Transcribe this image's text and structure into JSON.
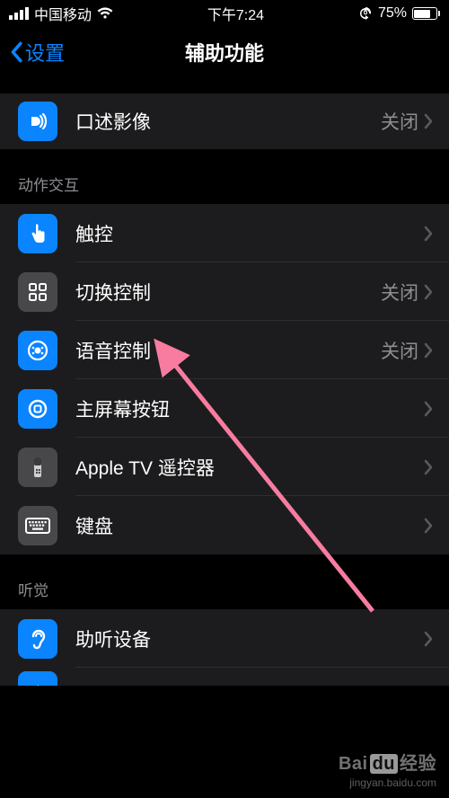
{
  "status": {
    "carrier": "中国移动",
    "time": "下午7:24",
    "battery_pct": "75%"
  },
  "nav": {
    "back_label": "设置",
    "title": "辅助功能"
  },
  "partial_top": {
    "label": "口述影像",
    "value": "关闭"
  },
  "section_motion": {
    "header": "动作交互",
    "items": [
      {
        "label": "触控",
        "value": "",
        "icon": "touch",
        "icon_bg": "blue"
      },
      {
        "label": "切换控制",
        "value": "关闭",
        "icon": "switch-control",
        "icon_bg": "gray"
      },
      {
        "label": "语音控制",
        "value": "关闭",
        "icon": "voice-control",
        "icon_bg": "blue"
      },
      {
        "label": "主屏幕按钮",
        "value": "",
        "icon": "home-button",
        "icon_bg": "blue"
      },
      {
        "label": "Apple TV 遥控器",
        "value": "",
        "icon": "appletv-remote",
        "icon_bg": "gray"
      },
      {
        "label": "键盘",
        "value": "",
        "icon": "keyboard",
        "icon_bg": "gray"
      }
    ]
  },
  "section_hearing": {
    "header": "听觉",
    "items": [
      {
        "label": "助听设备",
        "value": "",
        "icon": "hearing",
        "icon_bg": "blue"
      }
    ]
  },
  "watermark": {
    "main_a": "Bai",
    "main_b": "du",
    "main_c": "经验",
    "sub": "jingyan.baidu.com"
  },
  "annotation": {
    "target": "切换控制"
  }
}
